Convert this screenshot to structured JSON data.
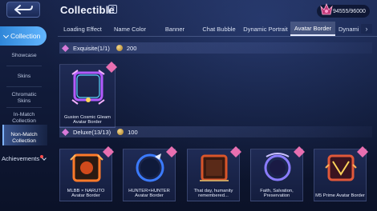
{
  "header": {
    "title": "Collectible",
    "help_icon": "?",
    "currency_value": "94555/96000"
  },
  "tabs": [
    {
      "label": "Loading Effect"
    },
    {
      "label": "Name Color"
    },
    {
      "label": "Banner"
    },
    {
      "label": "Chat Bubble"
    },
    {
      "label": "Dynamic Portrait"
    },
    {
      "label": "Avatar Border",
      "active": true
    },
    {
      "label": "Dynami"
    }
  ],
  "sidebar": {
    "main_label": "Collection",
    "items": [
      {
        "label": "Showcase"
      },
      {
        "label": "Skins"
      },
      {
        "label": "Chromatic Skins"
      },
      {
        "label": "In-Match Collection"
      },
      {
        "label": "Non-Match Collection",
        "active": true
      }
    ],
    "achievements_label": "Achievements"
  },
  "sections": [
    {
      "name": "Exquisite(1/1)",
      "points": "200",
      "items": [
        {
          "label": "Gusion Cosmic Gleam Avatar Border"
        }
      ]
    },
    {
      "name": "Deluxe(13/13)",
      "points": "100",
      "items": [
        {
          "label": "MLBB × NARUTO Avatar Border"
        },
        {
          "label": "HUNTER×HUNTER Avatar Border"
        },
        {
          "label": "That day, humanity remembered..."
        },
        {
          "label": "Faith, Salvation, Preservation"
        },
        {
          "label": "M5 Prime Avatar Border"
        }
      ]
    }
  ],
  "colors": {
    "accent_blue": "#4aa3f5",
    "background": "#101a38",
    "gold": "#d8b25a",
    "badge_pink": "#e86fb0"
  }
}
